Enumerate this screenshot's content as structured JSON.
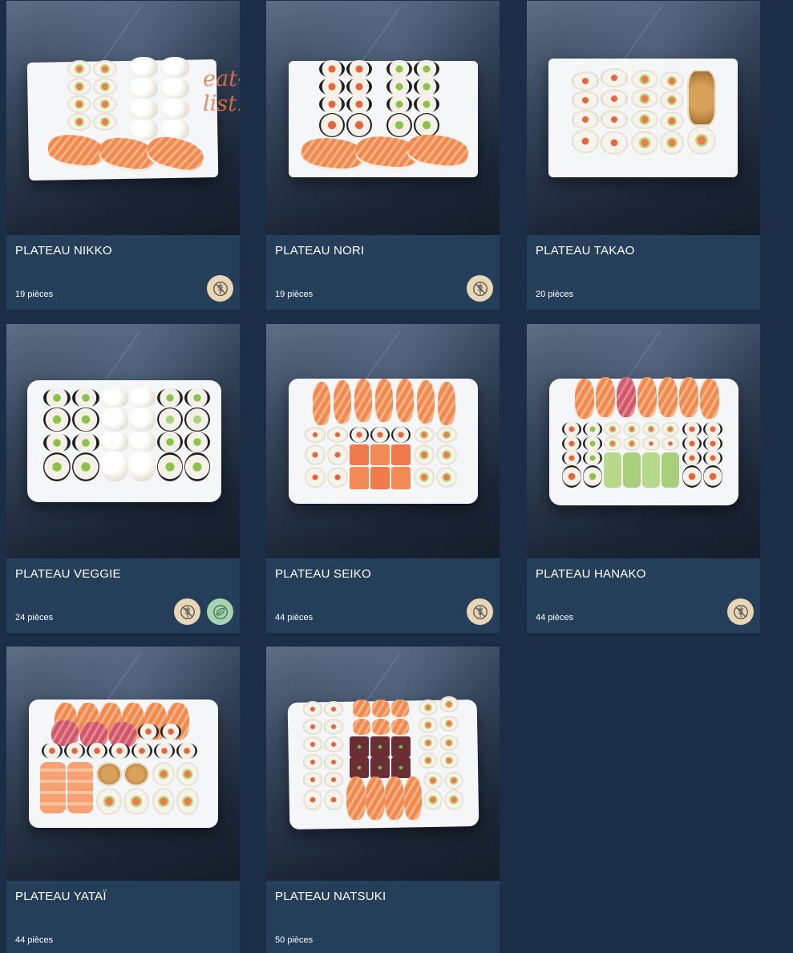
{
  "watermark": "eat-list.fr",
  "colors": {
    "page_background": "#1b2e46",
    "card_background": "#253f5b",
    "gluten_free_badge": "#e8d6b4",
    "vegetarian_badge": "#a7d3b3"
  },
  "products": [
    {
      "name": "PLATEAU NIKKO",
      "pieces": "19 pièces",
      "badges": [
        "gluten-free-icon"
      ]
    },
    {
      "name": "PLATEAU NORI",
      "pieces": "19 pièces",
      "badges": [
        "gluten-free-icon"
      ]
    },
    {
      "name": "PLATEAU TAKAO",
      "pieces": "20 pièces",
      "badges": []
    },
    {
      "name": "PLATEAU VEGGIE",
      "pieces": "24 pièces",
      "badges": [
        "gluten-free-icon",
        "vegetarian-leaf-icon"
      ]
    },
    {
      "name": "PLATEAU SEIKO",
      "pieces": "44 pièces",
      "badges": [
        "gluten-free-icon"
      ]
    },
    {
      "name": "PLATEAU HANAKO",
      "pieces": "44 pièces",
      "badges": [
        "gluten-free-icon"
      ]
    },
    {
      "name": "PLATEAU YATAÏ",
      "pieces": "44 pièces",
      "badges": []
    },
    {
      "name": "PLATEAU NATSUKI",
      "pieces": "50 pièces",
      "badges": []
    }
  ]
}
